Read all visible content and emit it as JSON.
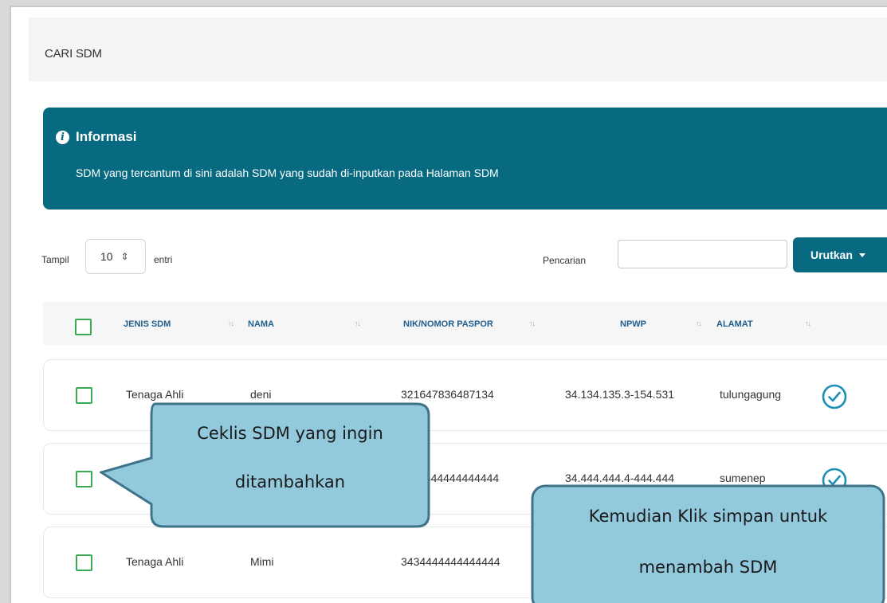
{
  "search_header": {
    "title": "CARI SDM"
  },
  "info": {
    "title": "Informasi",
    "message": "SDM yang tercantum di sini adalah SDM yang sudah di-inputkan pada Halaman SDM"
  },
  "controls": {
    "show_label": "Tampil",
    "entries_value": "10",
    "entries_suffix": "entri",
    "search_label": "Pencarian",
    "search_value": "",
    "sort_button": "Urutkan"
  },
  "table": {
    "headers": [
      "JENIS SDM",
      "NAMA",
      "NIK/NOMOR PASPOR",
      "NPWP",
      "ALAMAT"
    ],
    "sort_glyph": "↑↓",
    "rows": [
      {
        "jenis": "Tenaga Ahli",
        "nama": "deni",
        "nik": "321647836487134",
        "npwp": "34.134.135.3-154.531",
        "alamat": "tulungagung"
      },
      {
        "jenis": "",
        "nama": "",
        "nik": "4444444444444",
        "npwp": "34.444.444.4-444.444",
        "alamat": "sumenep"
      },
      {
        "jenis": "Tenaga Ahli",
        "nama": "Mimi",
        "nik": "3434444444444444",
        "npwp": "",
        "alamat": ""
      }
    ]
  },
  "annotations": {
    "callout_left_line1": "Ceklis SDM yang ingin",
    "callout_left_line2": "ditambahkan",
    "callout_right_line1": "Kemudian Klik simpan untuk",
    "callout_right_line2": "menambah SDM"
  },
  "colors": {
    "teal": "#086a80",
    "checkbox_green": "#3aa956",
    "callout_fill": "#92c9dc",
    "callout_border": "#3e7389"
  }
}
